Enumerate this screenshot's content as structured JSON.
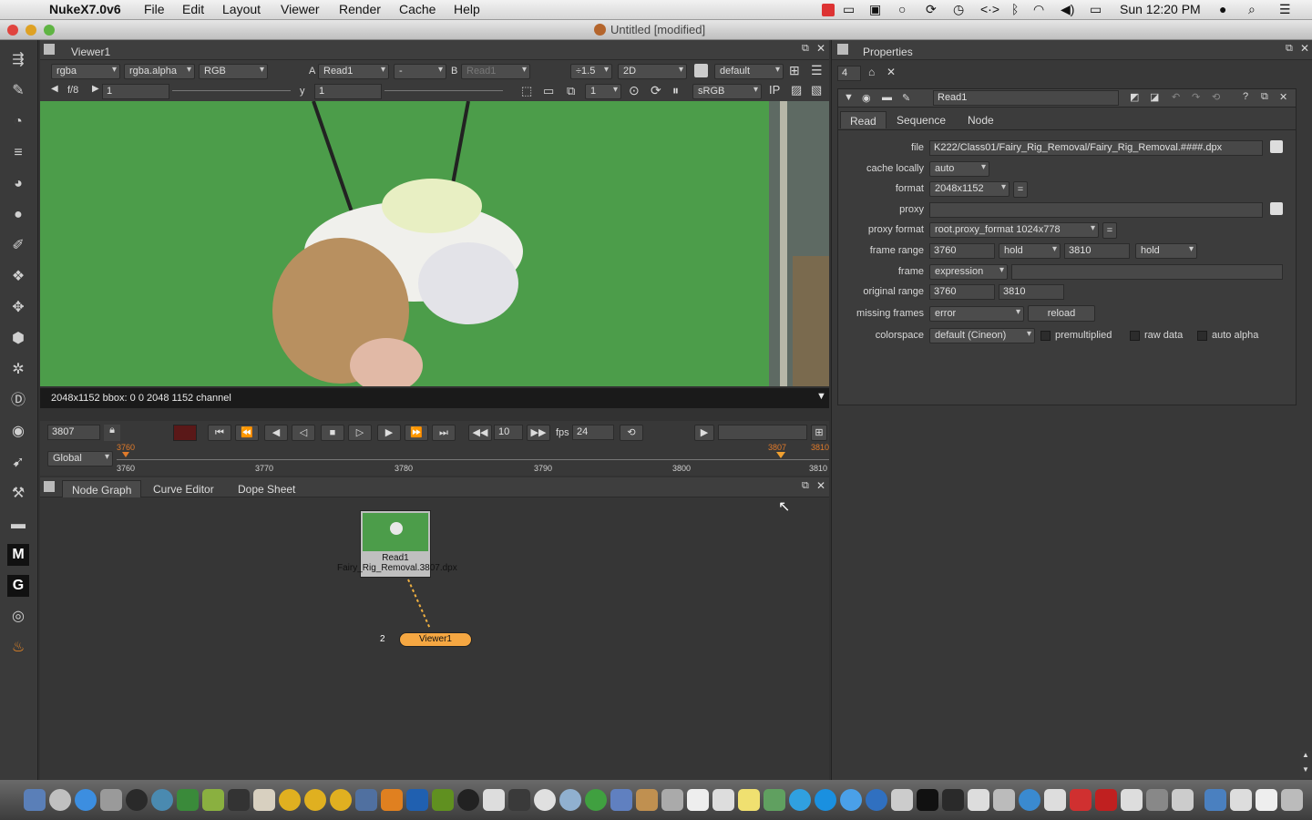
{
  "menubar": {
    "app_name": "NukeX7.0v6",
    "items": [
      "File",
      "Edit",
      "Layout",
      "Viewer",
      "Render",
      "Cache",
      "Help"
    ],
    "clock": "Sun 12:20 PM"
  },
  "window": {
    "title": "Untitled [modified]"
  },
  "viewer": {
    "tab_label": "Viewer1",
    "channels": "rgba",
    "alpha_channel": "rgba.alpha",
    "display": "RGB",
    "input_a_label": "A",
    "input_a": "Read1",
    "input_a_op": "-",
    "input_b_label": "B",
    "input_b": "Read1",
    "downrez": "÷1.5",
    "view_mode": "2D",
    "lut_preset": "default",
    "fstop": "f/8",
    "gain": "1",
    "gamma_label": "y",
    "gamma": "1",
    "proxy_scale": "1",
    "colorspace": "sRGB",
    "status": "2048x1152 bbox: 0 0 2048 1152 channel"
  },
  "playback": {
    "current_frame": "3807",
    "step": "10",
    "fps_label": "fps",
    "fps": "24",
    "range_mode": "Global",
    "in_marker": "3760",
    "playhead_marker": "3807",
    "out_marker": "3810",
    "ticks": [
      "3760",
      "3770",
      "3780",
      "3790",
      "3800",
      "3810"
    ]
  },
  "nodegraph": {
    "tabs": [
      "Node Graph",
      "Curve Editor",
      "Dope Sheet"
    ],
    "read_node_name": "Read1",
    "read_node_file": "Fairy_Rig_Removal.3807.dpx",
    "viewer_node_name": "Viewer1",
    "viewer_input_index": "2"
  },
  "properties": {
    "title": "Properties",
    "max_panels": "4",
    "node_name": "Read1",
    "tabs": [
      "Read",
      "Sequence",
      "Node"
    ],
    "file_label": "file",
    "file": "K222/Class01/Fairy_Rig_Removal/Fairy_Rig_Removal.####.dpx",
    "cache_label": "cache locally",
    "cache": "auto",
    "format_label": "format",
    "format": "2048x1152",
    "proxy_label": "proxy",
    "proxy": "",
    "proxy_format_label": "proxy format",
    "proxy_format": "root.proxy_format 1024x778",
    "eq": "=",
    "frame_range_label": "frame range",
    "frame_start": "3760",
    "before": "hold",
    "frame_end": "3810",
    "after": "hold",
    "frame_label": "frame",
    "frame_mode": "expression",
    "original_range_label": "original range",
    "orig_start": "3760",
    "orig_end": "3810",
    "missing_label": "missing frames",
    "missing": "error",
    "reload": "reload",
    "colorspace_label": "colorspace",
    "colorspace": "default (Cineon)",
    "premultiplied": "premultiplied",
    "raw_data": "raw data",
    "auto_alpha": "auto alpha"
  },
  "colors": {
    "greenscreen": "#4a9a48",
    "viewer_node": "#f5a742",
    "timeline_marker": "#e07a2a"
  }
}
